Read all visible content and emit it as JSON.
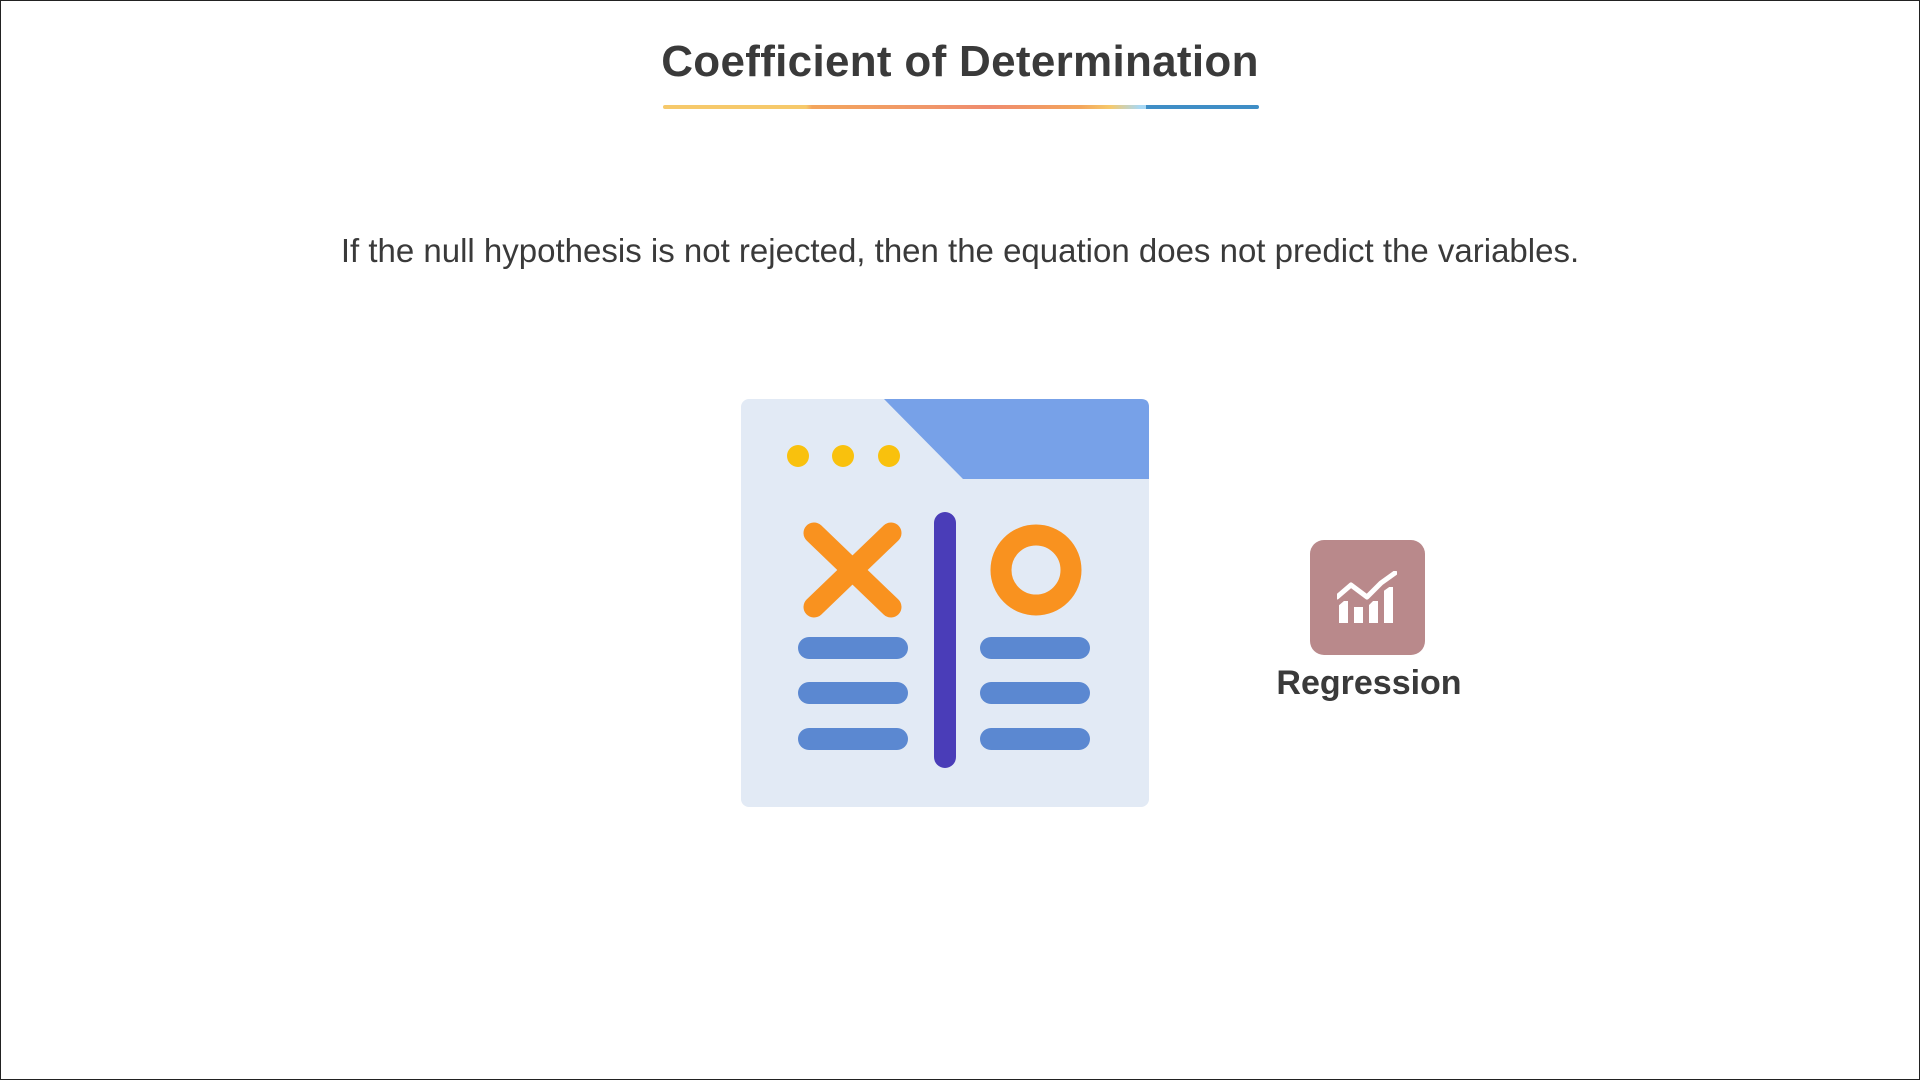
{
  "slide": {
    "title": "Coefficient of Determination",
    "statement": "If the null hypothesis is not rejected, then the equation does not predict the variables."
  },
  "illustration": {
    "icon": "tic-tac-toe-document-icon",
    "colors": {
      "panel": "#e2eaf5",
      "header": "#77a1e8",
      "dots": "#f9c10d",
      "symbols": "#f9921f",
      "divider": "#4a3db8",
      "lines": "#5b88d1"
    }
  },
  "badge": {
    "icon": "regression-chart-icon",
    "label": "Regression",
    "color": "#b9898b"
  }
}
